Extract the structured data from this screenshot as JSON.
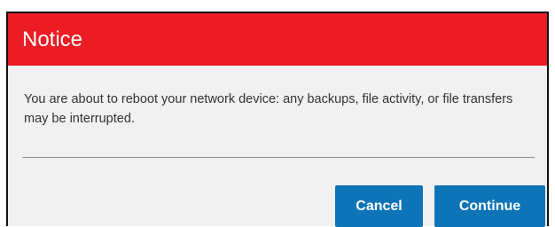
{
  "dialog": {
    "title": "Notice",
    "message": "You are about to reboot your network device: any backups, file activity, or file transfers may be interrupted.",
    "buttons": {
      "cancel_label": "Cancel",
      "continue_label": "Continue"
    }
  },
  "colors": {
    "titlebar": "#ec1c24",
    "button": "#0e74b8",
    "background": "#f1f1f1"
  }
}
